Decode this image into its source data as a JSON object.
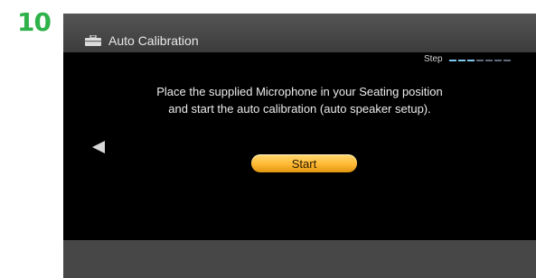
{
  "step_number": "10",
  "window": {
    "title": "Auto Calibration",
    "title_icon": "toolbox-icon"
  },
  "progress": {
    "label": "Step",
    "total_steps": 7,
    "current_step": 3
  },
  "message": {
    "line1": "Place the supplied Microphone in your Seating position",
    "line2": "and start the auto calibration (auto speaker setup)."
  },
  "navigation": {
    "back_icon": "left-arrow-icon"
  },
  "start_button": {
    "label": "Start"
  },
  "colors": {
    "step_number": "#2fb24a",
    "title_bar": "#444444",
    "background": "#000000",
    "footer": "#474747",
    "start_button": "#ffb934",
    "step_active": "#7ec8ef",
    "step_inactive": "#5d6b7a"
  }
}
